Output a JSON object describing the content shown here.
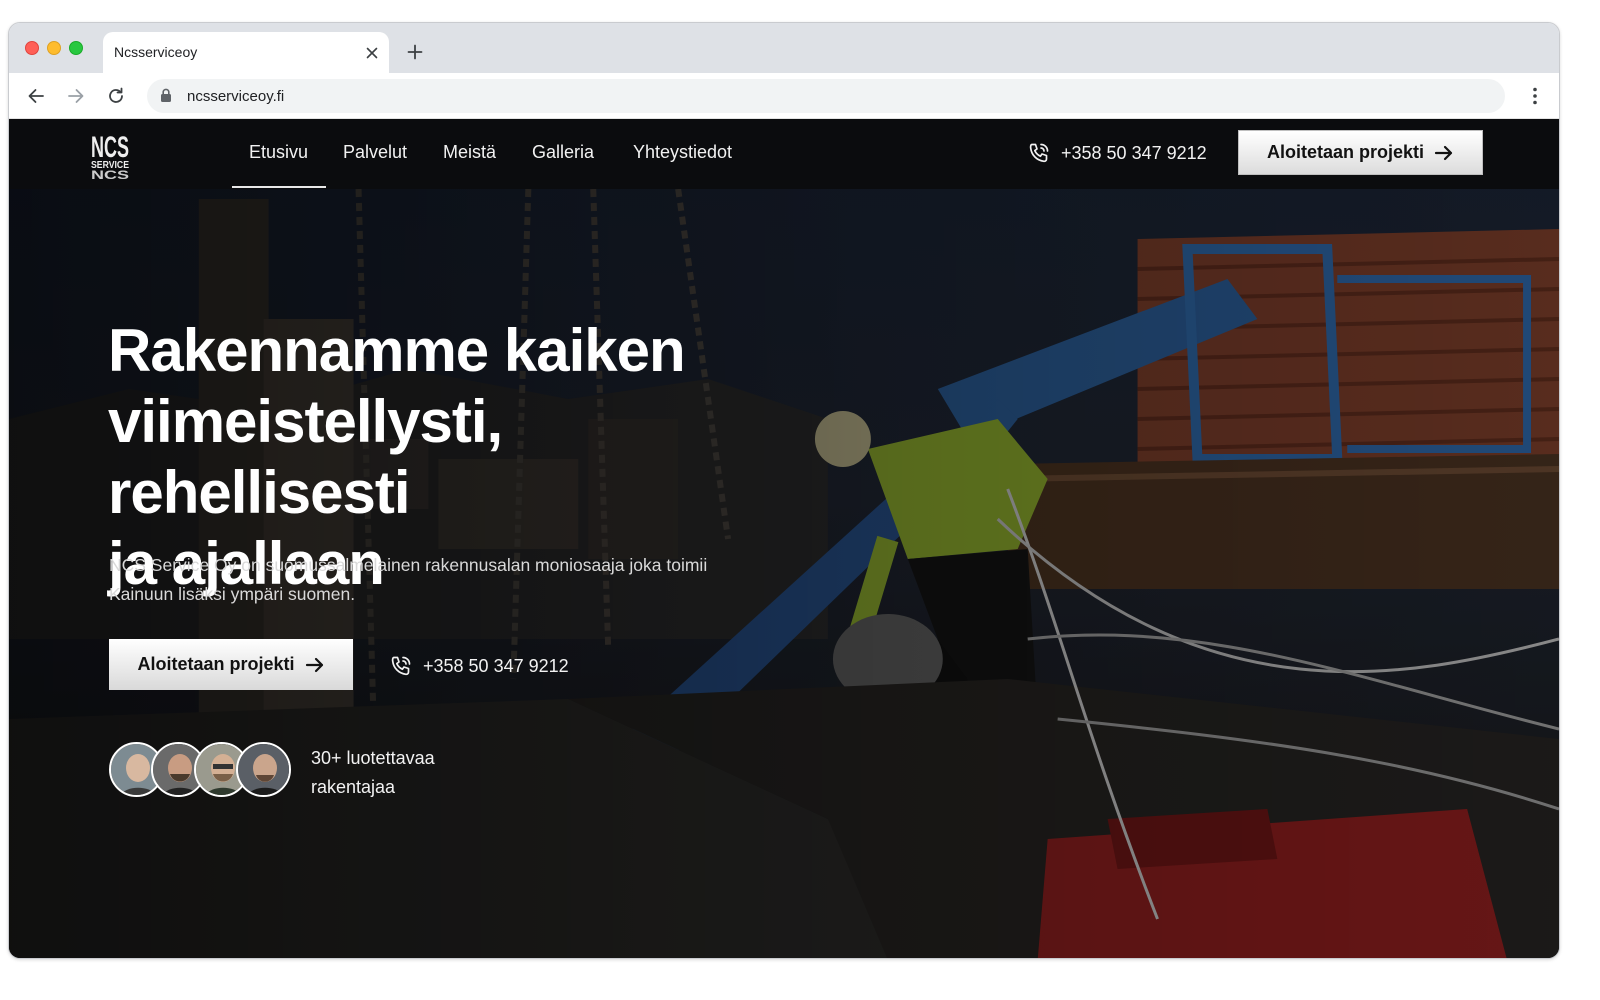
{
  "browser": {
    "tab_title": "Ncsserviceoy",
    "url": "ncsserviceoy.fi",
    "icons": [
      "close-icon",
      "plus-icon",
      "arrow-left-icon",
      "arrow-right-icon",
      "reload-icon",
      "lock-icon",
      "more-vert-icon"
    ]
  },
  "site": {
    "logo": {
      "top": "NCS",
      "bottom": "SERVICE"
    },
    "nav": {
      "items": [
        "Etusivu",
        "Palvelut",
        "Meistä",
        "Galleria",
        "Yhteystiedot"
      ],
      "active": "Etusivu",
      "phone": "+358 50 347 9212",
      "cta": "Aloitetaan projekti"
    },
    "hero": {
      "title_lines": [
        "Rakennamme kaiken",
        "viimeistellysti, rehellisesti",
        "ja ajallaan"
      ],
      "subtitle_lines": [
        "NCS Service Oy on suomussalmelainen rakennusalan moniosaaja joka toimii",
        "Kainuun lisäksi ympäri suomen."
      ],
      "cta": "Aloitetaan projekti",
      "phone": "+358 50 347 9212",
      "trust_lines": [
        "30+ luotettavaa",
        "rakentajaa"
      ]
    }
  },
  "colors": {
    "nav_bg": "#0b0c0e",
    "cta_bg": "#ffffff",
    "text_light": "#f2f2f2"
  }
}
